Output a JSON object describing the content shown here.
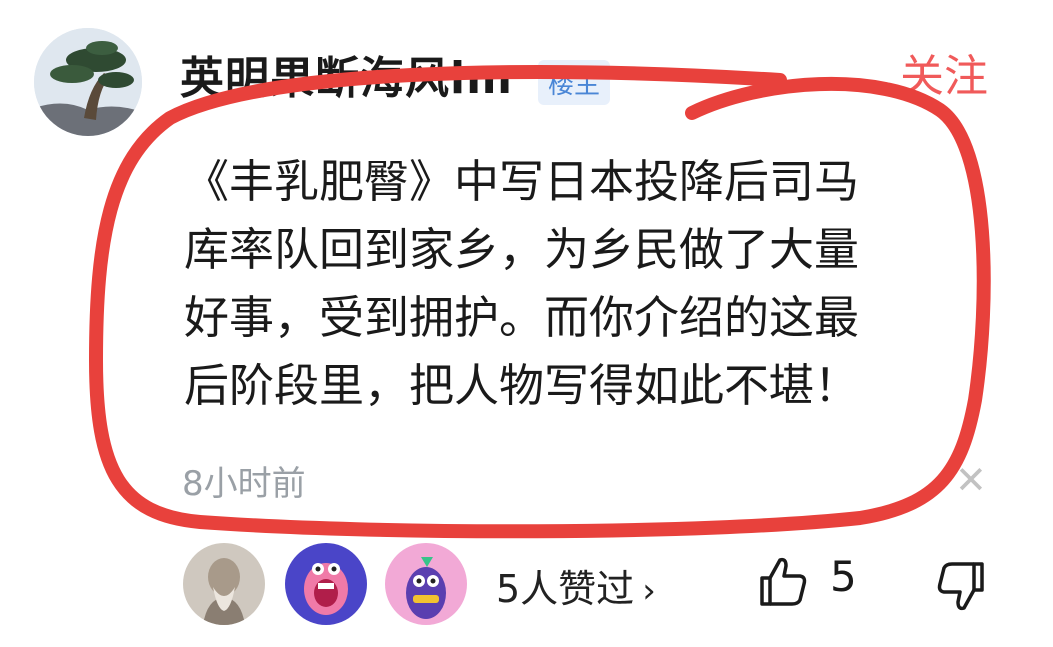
{
  "post": {
    "username": "英明果断海风lm",
    "badge": "楼主",
    "follow_label": "关注",
    "content_lines": [
      "《丰乳肥臀》中写日本投降后司马",
      "库率队回到家乡，为乡民做了大量",
      "好事，受到拥护。而你介绍的这最",
      "后阶段里，把人物写得如此不堪！"
    ],
    "time": "8小时前",
    "close_icon": "close-icon"
  },
  "likes": {
    "text": "5人赞过",
    "chevron": "›",
    "count": "5",
    "avatars": [
      "elder-portrait-avatar",
      "pink-monster-avatar",
      "purple-monster-avatar"
    ]
  },
  "colors": {
    "follow": "#f05a5a",
    "badge_bg": "#e8f0fb",
    "badge_text": "#4a86d6",
    "annotation_red": "#e8413c",
    "muted": "#9aa0a6"
  }
}
